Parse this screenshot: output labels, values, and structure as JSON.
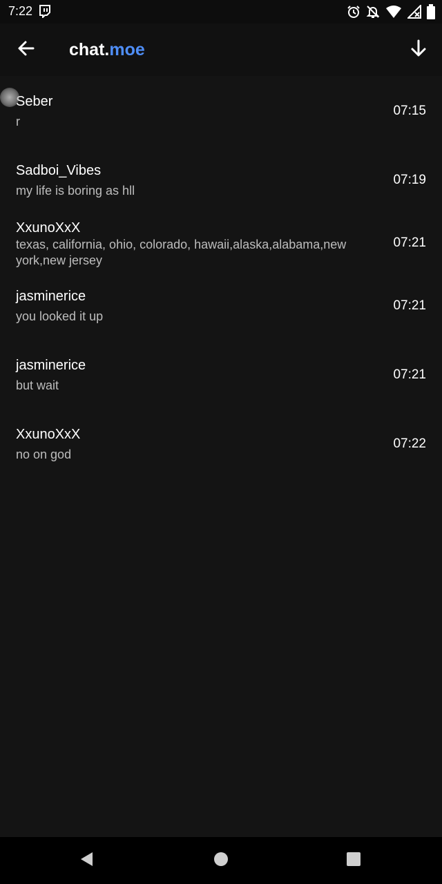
{
  "status_bar": {
    "time": "7:22",
    "left_icon": "twitch-icon",
    "right_icons": [
      "alarm-icon",
      "notifications-off-icon",
      "wifi-icon",
      "signal-icon",
      "battery-icon"
    ]
  },
  "app_bar": {
    "title_main": "chat.",
    "title_accent": "moe",
    "accent_color": "#4f8ef7",
    "back_icon": "arrow-left-icon",
    "action_icon": "arrow-down-icon"
  },
  "messages": [
    {
      "user": "Seber",
      "text": "r",
      "time": "07:15"
    },
    {
      "user": "Sadboi_Vibes",
      "text": "my life is boring as hll",
      "time": "07:19"
    },
    {
      "user": "XxunoXxX",
      "text": "texas, california, ohio, colorado, hawaii,alaska,alabama,new york,new jersey",
      "time": "07:21"
    },
    {
      "user": "jasminerice",
      "text": "you looked it up",
      "time": "07:21"
    },
    {
      "user": "jasminerice",
      "text": "but wait",
      "time": "07:21"
    },
    {
      "user": "XxunoXxX",
      "text": "no on god",
      "time": "07:22"
    }
  ],
  "nav_bar": {
    "icons": [
      "back-triangle-icon",
      "home-circle-icon",
      "recents-square-icon"
    ]
  }
}
